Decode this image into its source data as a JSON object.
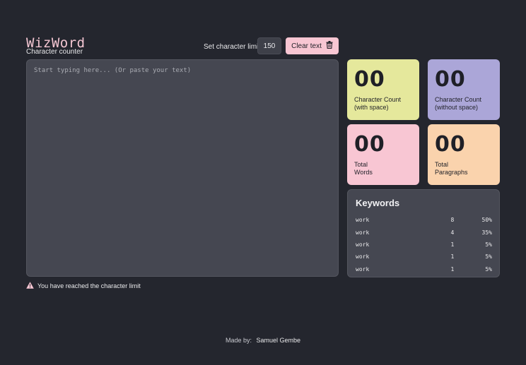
{
  "header": {
    "logo_title": "WizWord",
    "logo_subtitle": "Character counter",
    "limit_label": "Set character limit:",
    "limit_value": "150",
    "clear_label": "Clear text"
  },
  "editor": {
    "placeholder": "Start typing here... (Or paste your text)",
    "value": ""
  },
  "warning": {
    "text": "You have reached the character limit"
  },
  "stats": [
    {
      "value": "00",
      "label": "Character Count\n(with space)",
      "color": "#e5e89c"
    },
    {
      "value": "00",
      "label": "Character Count\n(without space)",
      "color": "#aba6d8"
    },
    {
      "value": "00",
      "label": "Total\nWords",
      "color": "#f8c6d3"
    },
    {
      "value": "00",
      "label": "Total\nParagraphs",
      "color": "#fad3ad"
    }
  ],
  "keywords": {
    "title": "Keywords",
    "rows": [
      {
        "word": "work",
        "count": "8",
        "percent": "50%"
      },
      {
        "word": "work",
        "count": "4",
        "percent": "35%"
      },
      {
        "word": "work",
        "count": "1",
        "percent": "5%"
      },
      {
        "word": "work",
        "count": "1",
        "percent": "5%"
      },
      {
        "word": "work",
        "count": "1",
        "percent": "5%"
      }
    ]
  },
  "footer": {
    "made_by": "Made by:",
    "author": "Samuel Gembe"
  },
  "icons": {
    "trash": "trash-icon",
    "warning": "warning-icon"
  },
  "colors": {
    "background": "#24262e",
    "panel": "#454751",
    "accent_pink": "#f8c6d3"
  }
}
